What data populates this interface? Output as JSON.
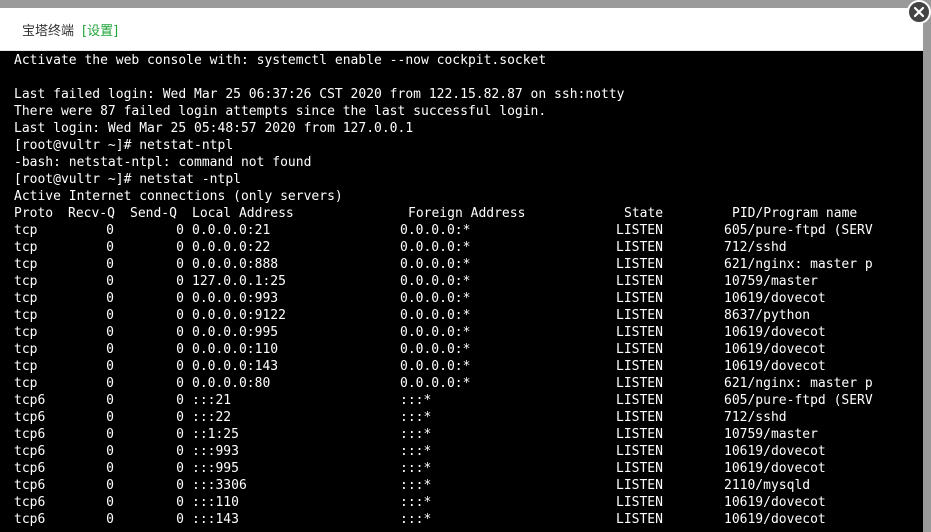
{
  "window": {
    "title": "宝塔终端",
    "settings_link": "[设置]"
  },
  "terminal": {
    "lines": [
      "Activate the web console with: systemctl enable --now cockpit.socket",
      "",
      "Last failed login: Wed Mar 25 06:37:26 CST 2020 from 122.15.82.87 on ssh:notty",
      "There were 87 failed login attempts since the last successful login.",
      "Last login: Wed Mar 25 05:48:57 2020 from 127.0.0.1",
      "[root@vultr ~]# netstat-ntpl",
      "-bash: netstat-ntpl: command not found",
      "[root@vultr ~]# netstat -ntpl",
      "Active Internet connections (only servers)"
    ],
    "netstat": {
      "headers": {
        "proto": "Proto",
        "recvq": "Recv-Q",
        "sendq": "Send-Q",
        "local": "Local Address",
        "foreign": "Foreign Address",
        "state": "State",
        "pid": "PID/Program name"
      },
      "rows": [
        {
          "proto": "tcp",
          "recvq": "0",
          "sendq": "0",
          "local": "0.0.0.0:21",
          "foreign": "0.0.0.0:*",
          "state": "LISTEN",
          "pid": "605/pure-ftpd (SERV"
        },
        {
          "proto": "tcp",
          "recvq": "0",
          "sendq": "0",
          "local": "0.0.0.0:22",
          "foreign": "0.0.0.0:*",
          "state": "LISTEN",
          "pid": "712/sshd"
        },
        {
          "proto": "tcp",
          "recvq": "0",
          "sendq": "0",
          "local": "0.0.0.0:888",
          "foreign": "0.0.0.0:*",
          "state": "LISTEN",
          "pid": "621/nginx: master p"
        },
        {
          "proto": "tcp",
          "recvq": "0",
          "sendq": "0",
          "local": "127.0.0.1:25",
          "foreign": "0.0.0.0:*",
          "state": "LISTEN",
          "pid": "10759/master"
        },
        {
          "proto": "tcp",
          "recvq": "0",
          "sendq": "0",
          "local": "0.0.0.0:993",
          "foreign": "0.0.0.0:*",
          "state": "LISTEN",
          "pid": "10619/dovecot"
        },
        {
          "proto": "tcp",
          "recvq": "0",
          "sendq": "0",
          "local": "0.0.0.0:9122",
          "foreign": "0.0.0.0:*",
          "state": "LISTEN",
          "pid": "8637/python"
        },
        {
          "proto": "tcp",
          "recvq": "0",
          "sendq": "0",
          "local": "0.0.0.0:995",
          "foreign": "0.0.0.0:*",
          "state": "LISTEN",
          "pid": "10619/dovecot"
        },
        {
          "proto": "tcp",
          "recvq": "0",
          "sendq": "0",
          "local": "0.0.0.0:110",
          "foreign": "0.0.0.0:*",
          "state": "LISTEN",
          "pid": "10619/dovecot"
        },
        {
          "proto": "tcp",
          "recvq": "0",
          "sendq": "0",
          "local": "0.0.0.0:143",
          "foreign": "0.0.0.0:*",
          "state": "LISTEN",
          "pid": "10619/dovecot"
        },
        {
          "proto": "tcp",
          "recvq": "0",
          "sendq": "0",
          "local": "0.0.0.0:80",
          "foreign": "0.0.0.0:*",
          "state": "LISTEN",
          "pid": "621/nginx: master p"
        },
        {
          "proto": "tcp6",
          "recvq": "0",
          "sendq": "0",
          "local": ":::21",
          "foreign": ":::*",
          "state": "LISTEN",
          "pid": "605/pure-ftpd (SERV"
        },
        {
          "proto": "tcp6",
          "recvq": "0",
          "sendq": "0",
          "local": ":::22",
          "foreign": ":::*",
          "state": "LISTEN",
          "pid": "712/sshd"
        },
        {
          "proto": "tcp6",
          "recvq": "0",
          "sendq": "0",
          "local": "::1:25",
          "foreign": ":::*",
          "state": "LISTEN",
          "pid": "10759/master"
        },
        {
          "proto": "tcp6",
          "recvq": "0",
          "sendq": "0",
          "local": ":::993",
          "foreign": ":::*",
          "state": "LISTEN",
          "pid": "10619/dovecot"
        },
        {
          "proto": "tcp6",
          "recvq": "0",
          "sendq": "0",
          "local": ":::995",
          "foreign": ":::*",
          "state": "LISTEN",
          "pid": "10619/dovecot"
        },
        {
          "proto": "tcp6",
          "recvq": "0",
          "sendq": "0",
          "local": ":::3306",
          "foreign": ":::*",
          "state": "LISTEN",
          "pid": "2110/mysqld"
        },
        {
          "proto": "tcp6",
          "recvq": "0",
          "sendq": "0",
          "local": ":::110",
          "foreign": ":::*",
          "state": "LISTEN",
          "pid": "10619/dovecot"
        },
        {
          "proto": "tcp6",
          "recvq": "0",
          "sendq": "0",
          "local": ":::143",
          "foreign": ":::*",
          "state": "LISTEN",
          "pid": "10619/dovecot"
        }
      ]
    }
  },
  "colors": {
    "terminal_bg": "#000000",
    "terminal_fg": "#ffffff",
    "settings_link": "#20a53a"
  },
  "icons": {
    "close": "close-icon"
  }
}
